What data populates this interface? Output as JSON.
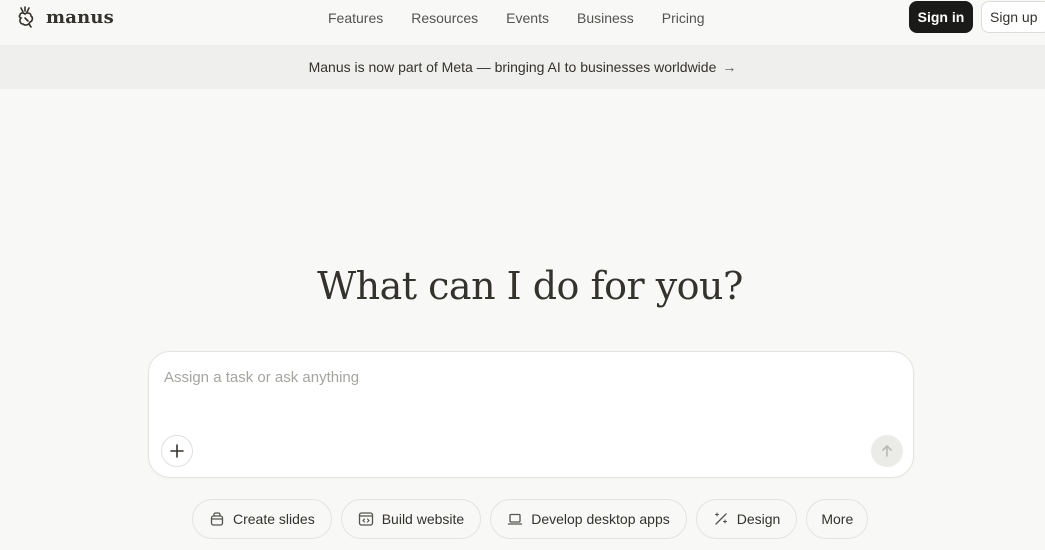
{
  "header": {
    "brand": "manus",
    "nav": [
      "Features",
      "Resources",
      "Events",
      "Business",
      "Pricing"
    ],
    "signin_label": "Sign in",
    "signup_label": "Sign up"
  },
  "banner": {
    "text": "Manus is now part of Meta — bringing AI to businesses worldwide",
    "arrow": "→"
  },
  "hero": {
    "title": "What can I do for you?"
  },
  "composer": {
    "placeholder": "Assign a task or ask anything",
    "plus_icon": "plus-icon",
    "send_icon": "arrow-up-icon"
  },
  "chips": [
    {
      "label": "Create slides",
      "icon": "slides-icon"
    },
    {
      "label": "Build website",
      "icon": "code-window-icon"
    },
    {
      "label": "Develop desktop apps",
      "icon": "laptop-icon"
    },
    {
      "label": "Design",
      "icon": "wand-icon"
    },
    {
      "label": "More",
      "icon": ""
    }
  ],
  "colors": {
    "background": "#f8f8f7",
    "banner": "#efefed",
    "primary_button": "#1a1a19",
    "text": "#34322d"
  }
}
